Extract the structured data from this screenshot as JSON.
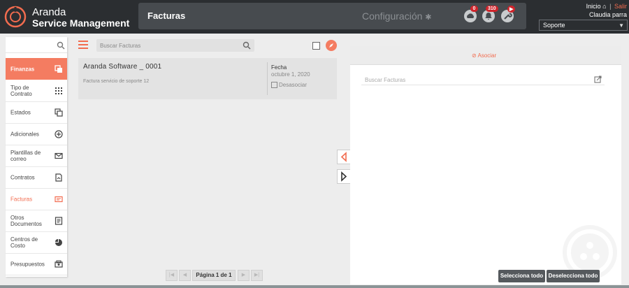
{
  "header": {
    "brand_line1": "Aranda",
    "brand_line2": "Service Management",
    "module_title": "Facturas",
    "config_label": "Configuración",
    "notifications": [
      {
        "icon": "cloud-icon",
        "count": "0"
      },
      {
        "icon": "bell-icon",
        "count": "310"
      },
      {
        "icon": "tools-icon",
        "count": "▶"
      }
    ],
    "home_link": "Inicio",
    "logout_link": "Salir",
    "user_name": "Claudia parra",
    "project_select": "Soporte",
    "colors": {
      "topbar": "#2b2e31",
      "accent": "#f26c4f",
      "badge": "#d0242b"
    }
  },
  "sidebar": {
    "items": [
      {
        "label": "Finanzas",
        "icon": "copy-icon"
      },
      {
        "label": "Tipo de Contrato",
        "icon": "grid-icon"
      },
      {
        "label": "Estados",
        "icon": "states-icon"
      },
      {
        "label": "Adicionales",
        "icon": "plus-circle-icon"
      },
      {
        "label": "Plantillas de correo",
        "icon": "envelope-icon"
      },
      {
        "label": "Contratos",
        "icon": "contract-icon"
      },
      {
        "label": "Facturas",
        "icon": "invoice-icon"
      },
      {
        "label": "Otros Documentos",
        "icon": "document-icon"
      },
      {
        "label": "Centros de Costo",
        "icon": "pie-icon"
      },
      {
        "label": "Presupuestos",
        "icon": "budget-icon"
      }
    ]
  },
  "list": {
    "search_placeholder": "Buscar Facturas",
    "card": {
      "title": "Aranda Software _ 0001",
      "description": "Factura servicio de soporte 12",
      "date_label": "Fecha",
      "date_value": "octubre 1, 2020",
      "unlink_label": "Desasociar"
    },
    "pager": {
      "label": "Página 1 de 1"
    }
  },
  "right": {
    "associate_label": "Asociar",
    "search_placeholder": "Buscar Facturas",
    "select_all": "Selecciona todo",
    "deselect_all": "Deselecciona todo"
  }
}
